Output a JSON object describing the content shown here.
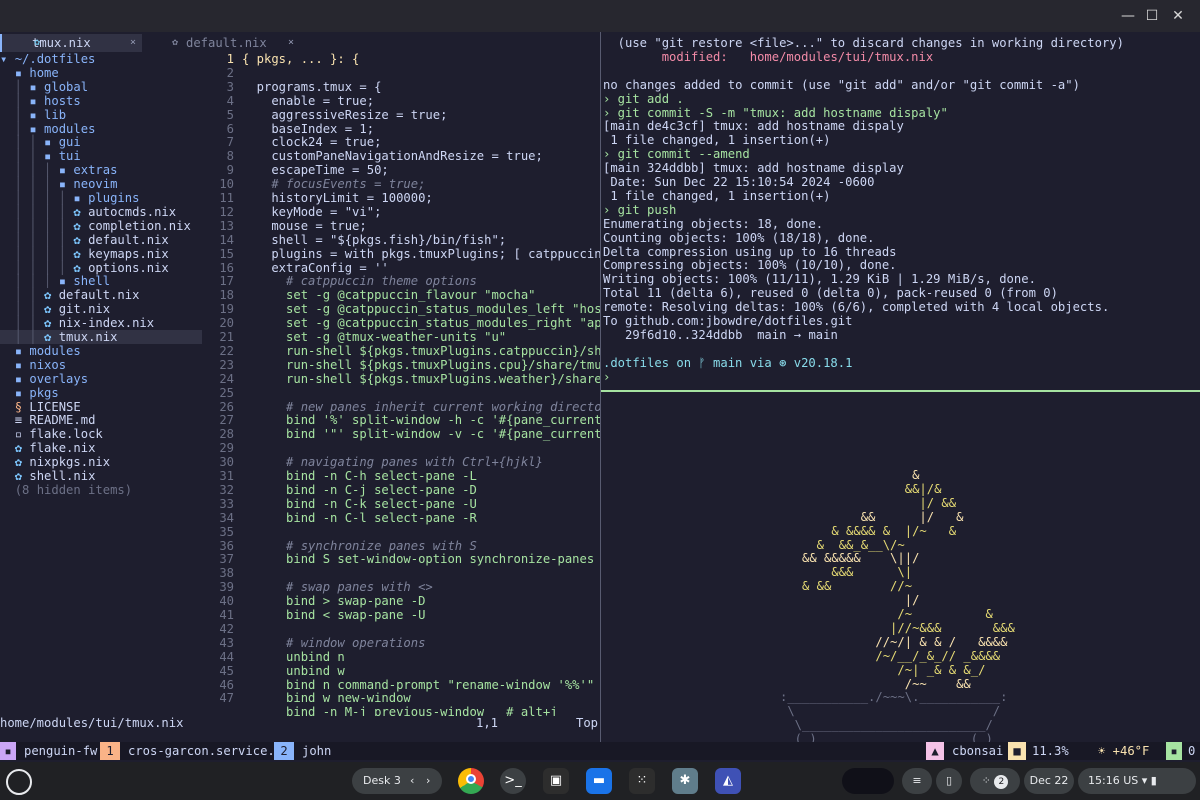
{
  "window": {
    "minimize_icon": "minimize-icon",
    "maximize_icon": "maximize-icon",
    "close_icon": "close-icon"
  },
  "nvim": {
    "tabs": [
      {
        "label": "tmux.nix",
        "close": "×"
      },
      {
        "label": "default.nix",
        "close": "×"
      }
    ],
    "tree": [
      "~/.dotfiles",
      "home",
      "global",
      "hosts",
      "lib",
      "modules",
      "gui",
      "tui",
      "extras",
      "neovim",
      "plugins",
      "autocmds.nix",
      "completion.nix",
      "default.nix",
      "keymaps.nix",
      "options.nix",
      "shell",
      "default.nix",
      "git.nix",
      "nix-index.nix",
      "tmux.nix",
      "modules",
      "nixos",
      "overlays",
      "pkgs",
      "LICENSE",
      "README.md",
      "flake.lock",
      "flake.nix",
      "nixpkgs.nix",
      "shell.nix",
      "(8 hidden items)"
    ],
    "status": {
      "path": "home/modules/tui/tmux.nix",
      "pos": "1,1",
      "scroll": "Top"
    }
  },
  "code": [
    "{ pkgs, ... }: {",
    "",
    "  programs.tmux = {",
    "    enable = true;",
    "    aggressiveResize = true;",
    "    baseIndex = 1;",
    "    clock24 = true;",
    "    customPaneNavigationAndResize = true;",
    "    escapeTime = 50;",
    "    # focusEvents = true;",
    "    historyLimit = 100000;",
    "    keyMode = \"vi\";",
    "    mouse = true;",
    "    shell = \"${pkgs.fish}/bin/fish\";",
    "    plugins = with pkgs.tmuxPlugins; [ catppuccin cp",
    "    extraConfig = ''",
    "      # catppuccin theme options",
    "      set -g @catppuccin_flavour \"mocha\"",
    "      set -g @catppuccin_status_modules_left \"host\"",
    "      set -g @catppuccin_status_modules_right \"appli",
    "      set -g @tmux-weather-units \"u\"",
    "      run-shell ${pkgs.tmuxPlugins.catppuccin}/share",
    "      run-shell ${pkgs.tmuxPlugins.cpu}/share/tmux-p",
    "      run-shell ${pkgs.tmuxPlugins.weather}/share/tm",
    "",
    "      # new panes inherit current working directory",
    "      bind '%' split-window -h -c '#{pane_current_pa",
    "      bind '\"' split-window -v -c '#{pane_current_pa",
    "",
    "      # navigating panes with Ctrl+{hjkl}",
    "      bind -n C-h select-pane -L",
    "      bind -n C-j select-pane -D",
    "      bind -n C-k select-pane -U",
    "      bind -n C-l select-pane -R",
    "",
    "      # synchronize panes with S",
    "      bind S set-window-option synchronize-panes \\;",
    "",
    "      # swap panes with <>",
    "      bind > swap-pane -D",
    "      bind < swap-pane -U",
    "",
    "      # window operations",
    "      unbind n",
    "      unbind w",
    "      bind n command-prompt \"rename-window '%%'\"",
    "      bind w new-window",
    "      bind -n M-j previous-window   # alt+j"
  ],
  "line_numbers": [
    "1",
    "1",
    "2",
    "3",
    "4",
    "5",
    "6",
    "7",
    "8",
    "9",
    "10",
    "11",
    "12",
    "13",
    "14",
    "15",
    "16",
    "17",
    "18",
    "19",
    "20",
    "21",
    "22",
    "23",
    "24",
    "25",
    "26",
    "27",
    "28",
    "29",
    "30",
    "31",
    "32",
    "33",
    "34",
    "35",
    "36",
    "37",
    "38",
    "39",
    "40",
    "41",
    "42",
    "43",
    "44",
    "45",
    "46",
    "47"
  ],
  "shell": [
    "  (use \"git restore <file>...\" to discard changes in working directory)",
    "        modified:   home/modules/tui/tmux.nix",
    "",
    "no changes added to commit (use \"git add\" and/or \"git commit -a\")",
    "› git add .",
    "› git commit -S -m \"tmux: add hostname dispaly\"",
    "[main de4c3cf] tmux: add hostname dispaly",
    " 1 file changed, 1 insertion(+)",
    "› git commit --amend",
    "[main 324ddbb] tmux: add hostname display",
    " Date: Sun Dec 22 15:10:54 2024 -0600",
    " 1 file changed, 1 insertion(+)",
    "› git push",
    "Enumerating objects: 18, done.",
    "Counting objects: 100% (18/18), done.",
    "Delta compression using up to 16 threads",
    "Compressing objects: 100% (10/10), done.",
    "Writing objects: 100% (11/11), 1.29 KiB | 1.29 MiB/s, done.",
    "Total 11 (delta 6), reused 0 (delta 0), pack-reused 0 (from 0)",
    "remote: Resolving deltas: 100% (6/6), completed with 4 local objects.",
    "To github.com:jbowdre/dotfiles.git",
    "   29f6d10..324ddbb  main → main",
    "",
    ".dotfiles on ᚠ main via ⊛ v20.18.1",
    "›"
  ],
  "bonsai": [
    "                  &",
    "                 &&|/&",
    "                   |/ &&",
    "           &&      |/   &",
    "       & &&&& &  |/~   &",
    "     &  &&_&__\\/~",
    "   && &&&&&    \\||/",
    "       &&&      \\|",
    "   & &&        //~",
    "                 |/",
    "                /~          &",
    "               |//~&&&       &&&",
    "             //~/| & & /   &&&&",
    "             /~/__/_&_// _&&&&",
    "                /~| _& & &_/",
    "                 /~~    &&",
    ":___________./~~~\\.___________:",
    " \\                           /",
    "  \\_________________________/",
    "  (_)                     (_)"
  ],
  "tmux": {
    "session": "penguin-fw",
    "win1_index": "1",
    "win1_name": "cros-garcon.service.d",
    "win2_index": "2",
    "win2_name": "john",
    "host": "cbonsai",
    "cpu": "11.3%",
    "weather": "☀ +46°F",
    "win_count": "0"
  },
  "shelf": {
    "desk": "Desk 3",
    "date": "Dec 22",
    "time": "15:16",
    "locale": "US",
    "notif_count": "2"
  }
}
